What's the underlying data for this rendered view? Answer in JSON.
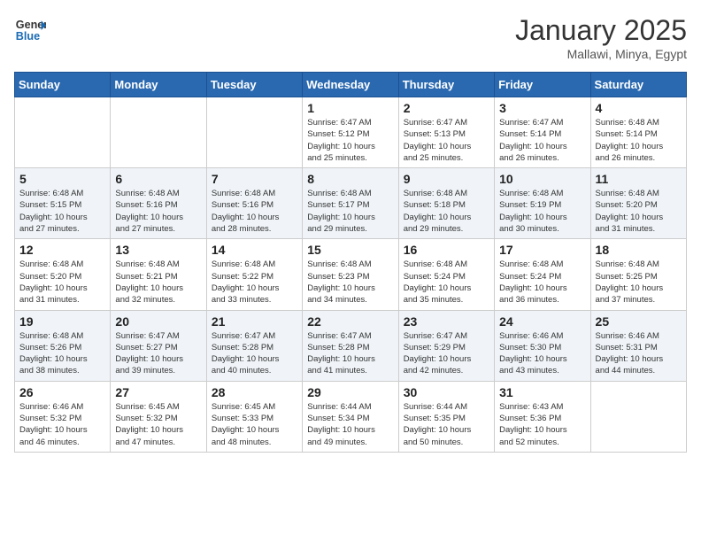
{
  "header": {
    "logo_line1": "General",
    "logo_line2": "Blue",
    "month_title": "January 2025",
    "subtitle": "Mallawi, Minya, Egypt"
  },
  "days_of_week": [
    "Sunday",
    "Monday",
    "Tuesday",
    "Wednesday",
    "Thursday",
    "Friday",
    "Saturday"
  ],
  "weeks": [
    [
      {
        "day": "",
        "info": ""
      },
      {
        "day": "",
        "info": ""
      },
      {
        "day": "",
        "info": ""
      },
      {
        "day": "1",
        "info": "Sunrise: 6:47 AM\nSunset: 5:12 PM\nDaylight: 10 hours\nand 25 minutes."
      },
      {
        "day": "2",
        "info": "Sunrise: 6:47 AM\nSunset: 5:13 PM\nDaylight: 10 hours\nand 25 minutes."
      },
      {
        "day": "3",
        "info": "Sunrise: 6:47 AM\nSunset: 5:14 PM\nDaylight: 10 hours\nand 26 minutes."
      },
      {
        "day": "4",
        "info": "Sunrise: 6:48 AM\nSunset: 5:14 PM\nDaylight: 10 hours\nand 26 minutes."
      }
    ],
    [
      {
        "day": "5",
        "info": "Sunrise: 6:48 AM\nSunset: 5:15 PM\nDaylight: 10 hours\nand 27 minutes."
      },
      {
        "day": "6",
        "info": "Sunrise: 6:48 AM\nSunset: 5:16 PM\nDaylight: 10 hours\nand 27 minutes."
      },
      {
        "day": "7",
        "info": "Sunrise: 6:48 AM\nSunset: 5:16 PM\nDaylight: 10 hours\nand 28 minutes."
      },
      {
        "day": "8",
        "info": "Sunrise: 6:48 AM\nSunset: 5:17 PM\nDaylight: 10 hours\nand 29 minutes."
      },
      {
        "day": "9",
        "info": "Sunrise: 6:48 AM\nSunset: 5:18 PM\nDaylight: 10 hours\nand 29 minutes."
      },
      {
        "day": "10",
        "info": "Sunrise: 6:48 AM\nSunset: 5:19 PM\nDaylight: 10 hours\nand 30 minutes."
      },
      {
        "day": "11",
        "info": "Sunrise: 6:48 AM\nSunset: 5:20 PM\nDaylight: 10 hours\nand 31 minutes."
      }
    ],
    [
      {
        "day": "12",
        "info": "Sunrise: 6:48 AM\nSunset: 5:20 PM\nDaylight: 10 hours\nand 31 minutes."
      },
      {
        "day": "13",
        "info": "Sunrise: 6:48 AM\nSunset: 5:21 PM\nDaylight: 10 hours\nand 32 minutes."
      },
      {
        "day": "14",
        "info": "Sunrise: 6:48 AM\nSunset: 5:22 PM\nDaylight: 10 hours\nand 33 minutes."
      },
      {
        "day": "15",
        "info": "Sunrise: 6:48 AM\nSunset: 5:23 PM\nDaylight: 10 hours\nand 34 minutes."
      },
      {
        "day": "16",
        "info": "Sunrise: 6:48 AM\nSunset: 5:24 PM\nDaylight: 10 hours\nand 35 minutes."
      },
      {
        "day": "17",
        "info": "Sunrise: 6:48 AM\nSunset: 5:24 PM\nDaylight: 10 hours\nand 36 minutes."
      },
      {
        "day": "18",
        "info": "Sunrise: 6:48 AM\nSunset: 5:25 PM\nDaylight: 10 hours\nand 37 minutes."
      }
    ],
    [
      {
        "day": "19",
        "info": "Sunrise: 6:48 AM\nSunset: 5:26 PM\nDaylight: 10 hours\nand 38 minutes."
      },
      {
        "day": "20",
        "info": "Sunrise: 6:47 AM\nSunset: 5:27 PM\nDaylight: 10 hours\nand 39 minutes."
      },
      {
        "day": "21",
        "info": "Sunrise: 6:47 AM\nSunset: 5:28 PM\nDaylight: 10 hours\nand 40 minutes."
      },
      {
        "day": "22",
        "info": "Sunrise: 6:47 AM\nSunset: 5:28 PM\nDaylight: 10 hours\nand 41 minutes."
      },
      {
        "day": "23",
        "info": "Sunrise: 6:47 AM\nSunset: 5:29 PM\nDaylight: 10 hours\nand 42 minutes."
      },
      {
        "day": "24",
        "info": "Sunrise: 6:46 AM\nSunset: 5:30 PM\nDaylight: 10 hours\nand 43 minutes."
      },
      {
        "day": "25",
        "info": "Sunrise: 6:46 AM\nSunset: 5:31 PM\nDaylight: 10 hours\nand 44 minutes."
      }
    ],
    [
      {
        "day": "26",
        "info": "Sunrise: 6:46 AM\nSunset: 5:32 PM\nDaylight: 10 hours\nand 46 minutes."
      },
      {
        "day": "27",
        "info": "Sunrise: 6:45 AM\nSunset: 5:32 PM\nDaylight: 10 hours\nand 47 minutes."
      },
      {
        "day": "28",
        "info": "Sunrise: 6:45 AM\nSunset: 5:33 PM\nDaylight: 10 hours\nand 48 minutes."
      },
      {
        "day": "29",
        "info": "Sunrise: 6:44 AM\nSunset: 5:34 PM\nDaylight: 10 hours\nand 49 minutes."
      },
      {
        "day": "30",
        "info": "Sunrise: 6:44 AM\nSunset: 5:35 PM\nDaylight: 10 hours\nand 50 minutes."
      },
      {
        "day": "31",
        "info": "Sunrise: 6:43 AM\nSunset: 5:36 PM\nDaylight: 10 hours\nand 52 minutes."
      },
      {
        "day": "",
        "info": ""
      }
    ]
  ]
}
